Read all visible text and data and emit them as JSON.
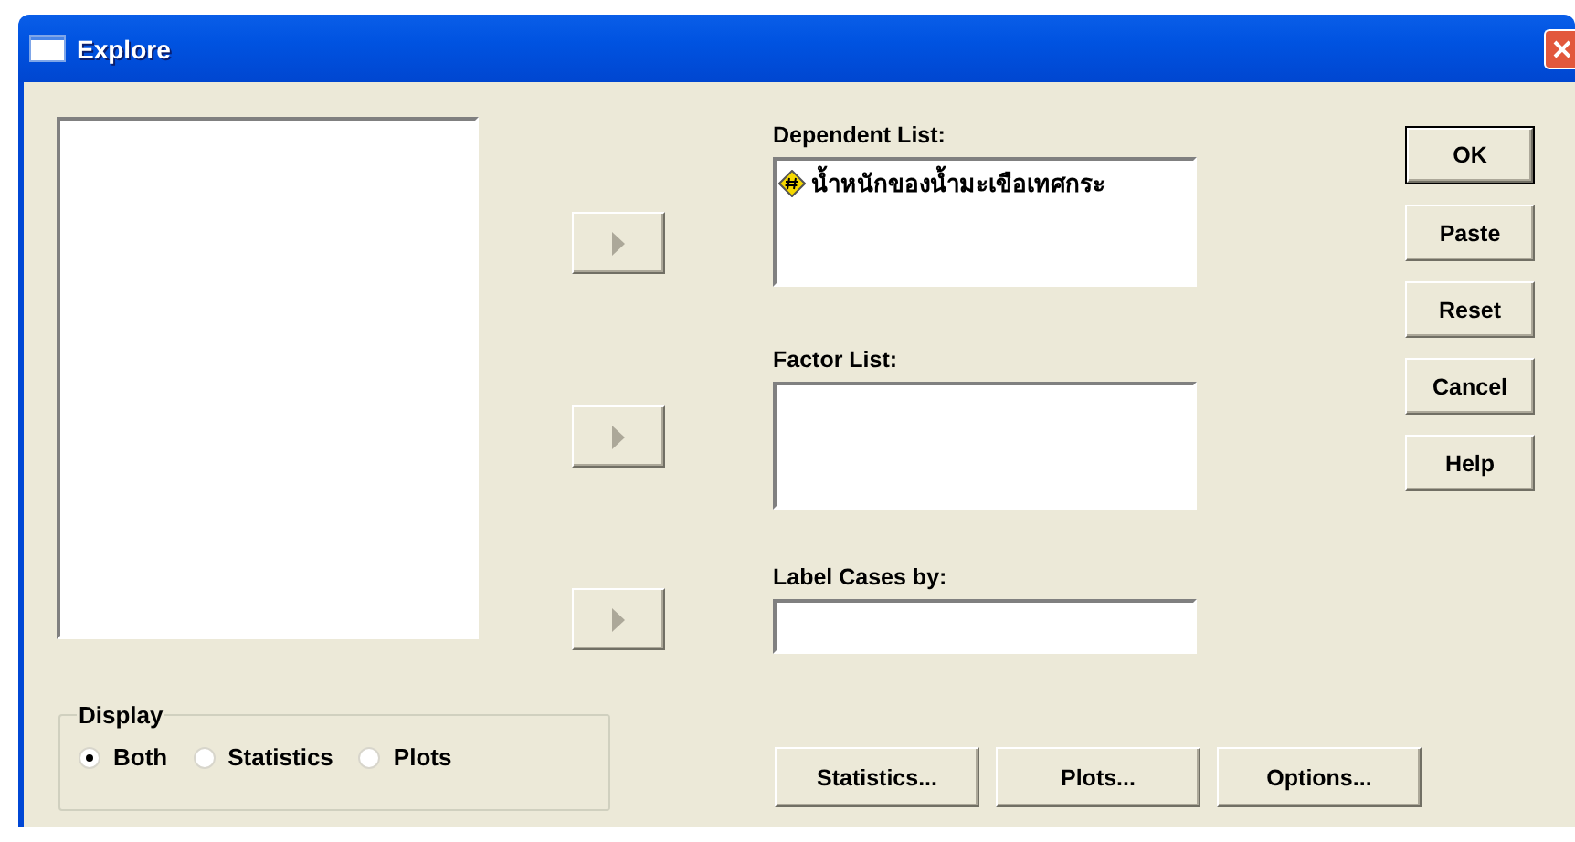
{
  "window": {
    "title": "Explore"
  },
  "dependent_list": {
    "label": "Dependent List:",
    "items": [
      {
        "text": "น้ำหนักของน้ำมะเขือเทศกระ"
      }
    ]
  },
  "factor_list": {
    "label": "Factor List:"
  },
  "label_cases": {
    "label": "Label Cases by:"
  },
  "side_buttons": [
    {
      "label": "OK",
      "default": true
    },
    {
      "label": "Paste",
      "default": false
    },
    {
      "label": "Reset",
      "default": false
    },
    {
      "label": "Cancel",
      "default": false
    },
    {
      "label": "Help",
      "default": false
    }
  ],
  "display": {
    "legend": "Display",
    "options": [
      {
        "label": "Both",
        "selected": true
      },
      {
        "label": "Statistics",
        "selected": false
      },
      {
        "label": "Plots",
        "selected": false
      }
    ]
  },
  "bottom_buttons": [
    "Statistics...",
    "Plots...",
    "Options..."
  ]
}
